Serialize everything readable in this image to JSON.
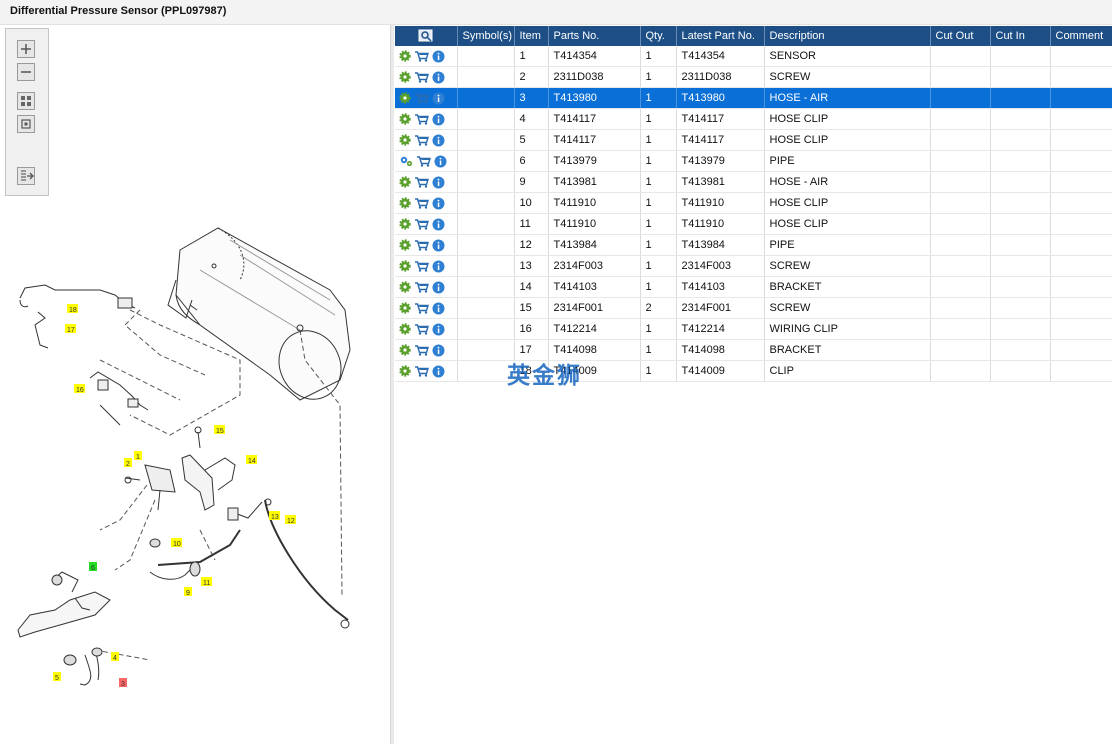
{
  "window": {
    "title": "Differential Pressure Sensor (PPL097987)"
  },
  "toolbar": [
    {
      "name": "zoom-in-button",
      "icon": "zoom-in-icon"
    },
    {
      "name": "zoom-out-button",
      "icon": "zoom-out-icon"
    },
    {
      "name": "fit-page-button",
      "icon": "fit-page-icon"
    },
    {
      "name": "actual-size-button",
      "icon": "actual-size-icon"
    },
    {
      "name": "export-button",
      "icon": "export-icon"
    }
  ],
  "diagram": {
    "callouts": [
      "18",
      "17",
      "16",
      "15",
      "14",
      "1",
      "2",
      "10",
      "13",
      "12",
      "9",
      "11",
      "6",
      "4",
      "5",
      "3"
    ]
  },
  "table": {
    "headers": [
      "",
      "Symbol(s)",
      "Item",
      "Parts No.",
      "Qty.",
      "Latest Part No.",
      "Description",
      "Cut Out",
      "Cut In",
      "Comment"
    ],
    "selected_index": 2,
    "rows": [
      {
        "item": "1",
        "part": "T414354",
        "qty": "1",
        "latest": "T414354",
        "desc": "SENSOR"
      },
      {
        "item": "2",
        "part": "2311D038",
        "qty": "1",
        "latest": "2311D038",
        "desc": "SCREW"
      },
      {
        "item": "3",
        "part": "T413980",
        "qty": "1",
        "latest": "T413980",
        "desc": "HOSE - AIR"
      },
      {
        "item": "4",
        "part": "T414117",
        "qty": "1",
        "latest": "T414117",
        "desc": "HOSE CLIP"
      },
      {
        "item": "5",
        "part": "T414117",
        "qty": "1",
        "latest": "T414117",
        "desc": "HOSE CLIP"
      },
      {
        "item": "6",
        "part": "T413979",
        "qty": "1",
        "latest": "T413979",
        "desc": "PIPE",
        "icon": "gears-icon"
      },
      {
        "item": "9",
        "part": "T413981",
        "qty": "1",
        "latest": "T413981",
        "desc": "HOSE - AIR"
      },
      {
        "item": "10",
        "part": "T411910",
        "qty": "1",
        "latest": "T411910",
        "desc": "HOSE CLIP"
      },
      {
        "item": "11",
        "part": "T411910",
        "qty": "1",
        "latest": "T411910",
        "desc": "HOSE CLIP"
      },
      {
        "item": "12",
        "part": "T413984",
        "qty": "1",
        "latest": "T413984",
        "desc": "PIPE"
      },
      {
        "item": "13",
        "part": "2314F003",
        "qty": "1",
        "latest": "2314F003",
        "desc": "SCREW"
      },
      {
        "item": "14",
        "part": "T414103",
        "qty": "1",
        "latest": "T414103",
        "desc": "BRACKET"
      },
      {
        "item": "15",
        "part": "2314F001",
        "qty": "2",
        "latest": "2314F001",
        "desc": "SCREW"
      },
      {
        "item": "16",
        "part": "T412214",
        "qty": "1",
        "latest": "T412214",
        "desc": "WIRING CLIP"
      },
      {
        "item": "17",
        "part": "T414098",
        "qty": "1",
        "latest": "T414098",
        "desc": "BRACKET"
      },
      {
        "item": "18",
        "part": "T414009",
        "qty": "1",
        "latest": "T414009",
        "desc": "CLIP"
      }
    ]
  },
  "watermark": {
    "text": "英金狮"
  },
  "colors": {
    "header": "#1d4e86",
    "selected": "#0a6fd6",
    "gear": "#5aa02c",
    "cart": "#2b6cb0",
    "info": "#2f7fd3",
    "callout": "#ffff00",
    "callout_green": "#22dd22",
    "callout_red": "#ff6666"
  }
}
